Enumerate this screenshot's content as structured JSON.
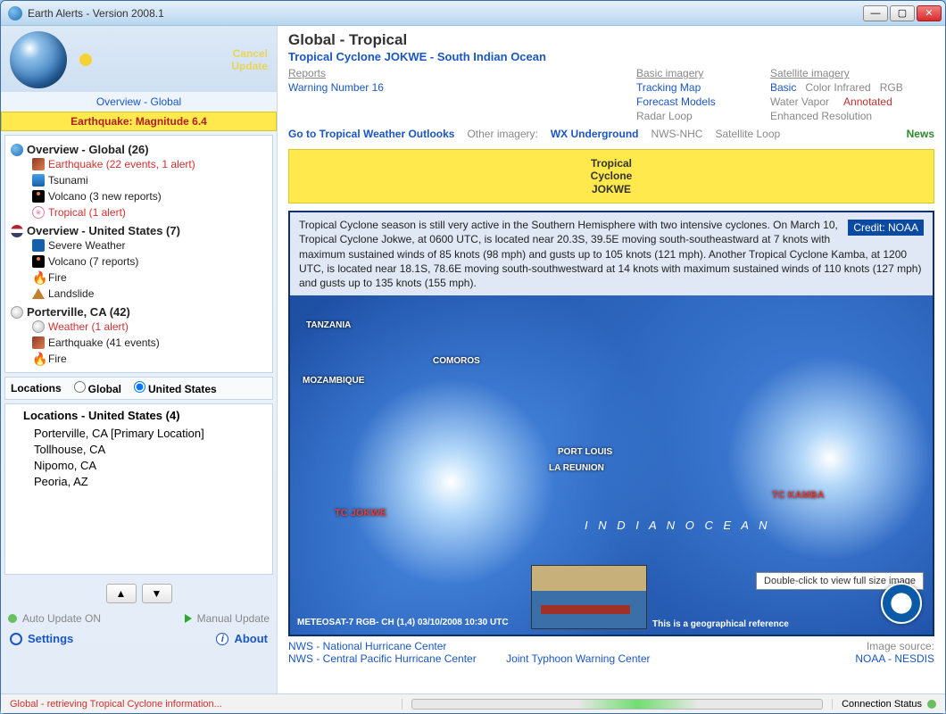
{
  "window": {
    "title": "Earth Alerts - Version 2008.1"
  },
  "left": {
    "cancel": "Cancel",
    "update": "Update",
    "overview_link": "Overview - Global",
    "alert_banner": "Earthquake: Magnitude 6.4",
    "groups": [
      {
        "title": "Overview - Global (26)",
        "icon": "globe",
        "items": [
          {
            "label": "Earthquake (22 events, 1 alert)",
            "icon": "quake",
            "alert": true
          },
          {
            "label": "Tsunami",
            "icon": "tsunami"
          },
          {
            "label": "Volcano (3 new reports)",
            "icon": "volcano"
          },
          {
            "label": "Tropical (1 alert)",
            "icon": "tropical",
            "alert": true
          }
        ]
      },
      {
        "title": "Overview - United States (7)",
        "icon": "us",
        "items": [
          {
            "label": "Severe Weather",
            "icon": "severe"
          },
          {
            "label": "Volcano (7 reports)",
            "icon": "volcano"
          },
          {
            "label": "Fire",
            "icon": "fire"
          },
          {
            "label": "Landslide",
            "icon": "landslide"
          }
        ]
      },
      {
        "title": "Porterville, CA (42)",
        "icon": "weather",
        "items": [
          {
            "label": "Weather (1 alert)",
            "icon": "weather",
            "alert": true
          },
          {
            "label": "Earthquake (41 events)",
            "icon": "quake"
          },
          {
            "label": "Fire",
            "icon": "fire"
          }
        ]
      }
    ],
    "loc_label": "Locations",
    "scope_global": "Global",
    "scope_us": "United States",
    "loc_list_title": "Locations - United States (4)",
    "locations": [
      "Porterville, CA [Primary Location]",
      "Tollhouse, CA",
      "Nipomo, CA",
      "Peoria, AZ"
    ],
    "auto_update": "Auto Update ON",
    "manual_update": "Manual Update",
    "settings": "Settings",
    "about": "About"
  },
  "right": {
    "title": "Global - Tropical",
    "subtitle": "Tropical Cyclone JOKWE - South Indian Ocean",
    "cols": {
      "reports": {
        "head": "Reports",
        "items": [
          "Warning Number 16"
        ]
      },
      "basic": {
        "head": "Basic imagery",
        "items": [
          "Tracking Map",
          "Forecast Models",
          "Radar Loop"
        ]
      },
      "sat": {
        "head": "Satellite imagery",
        "row1": [
          "Basic",
          "Color Infrared",
          "RGB"
        ],
        "row2": [
          "Water Vapor",
          "Annotated"
        ],
        "row3": [
          "Enhanced Resolution"
        ]
      }
    },
    "outlook": "Go to Tropical Weather Outlooks",
    "other_label": "Other imagery:",
    "other": [
      "WX Underground",
      "NWS-NHC",
      "Satellite Loop"
    ],
    "news": "News",
    "cyclone_box": "Tropical\nCyclone\nJOKWE",
    "desc": "Tropical Cyclone season is still very active in the Southern Hemisphere with two intensive cyclones. On March 10, Tropical Cyclone Jokwe, at 0600 UTC, is located near 20.3S, 39.5E moving south-southeastward at 7 knots with maximum sustained winds of 85 knots (98 mph) and gusts up to 105 knots (121 mph). Another Tropical Cyclone Kamba, at 1200 UTC, is located near 18.1S, 78.6E moving south-southwestward at 14 knots with maximum sustained winds of 110 knots (127 mph) and gusts up to 135 knots (155 mph).",
    "credit": "Credit: NOAA",
    "map_labels": {
      "tanzania": "TANZANIA",
      "mozambique": "MOZAMBIQUE",
      "comoros": "COMOROS",
      "portlouis": "PORT LOUIS",
      "lareunion": "LA REUNION",
      "ocean": "I N D I A N    O C E A N",
      "jokwe": "TC JOKWE",
      "kamba": "TC KAMBA"
    },
    "hint": "Double-click to view full size image",
    "georef": "This is a geographical reference",
    "caption": "METEOSAT-7 RGB- CH (1,4) 03/10/2008 10:30 UTC",
    "footer": {
      "l1": "NWS - National Hurricane Center",
      "l2": "NWS - Central Pacific Hurricane Center",
      "l3": "Joint Typhoon Warning Center",
      "src_lbl": "Image source:",
      "src": "NOAA - NESDIS"
    }
  },
  "status": {
    "msg": "Global - retrieving Tropical Cyclone information...",
    "conn": "Connection Status"
  }
}
